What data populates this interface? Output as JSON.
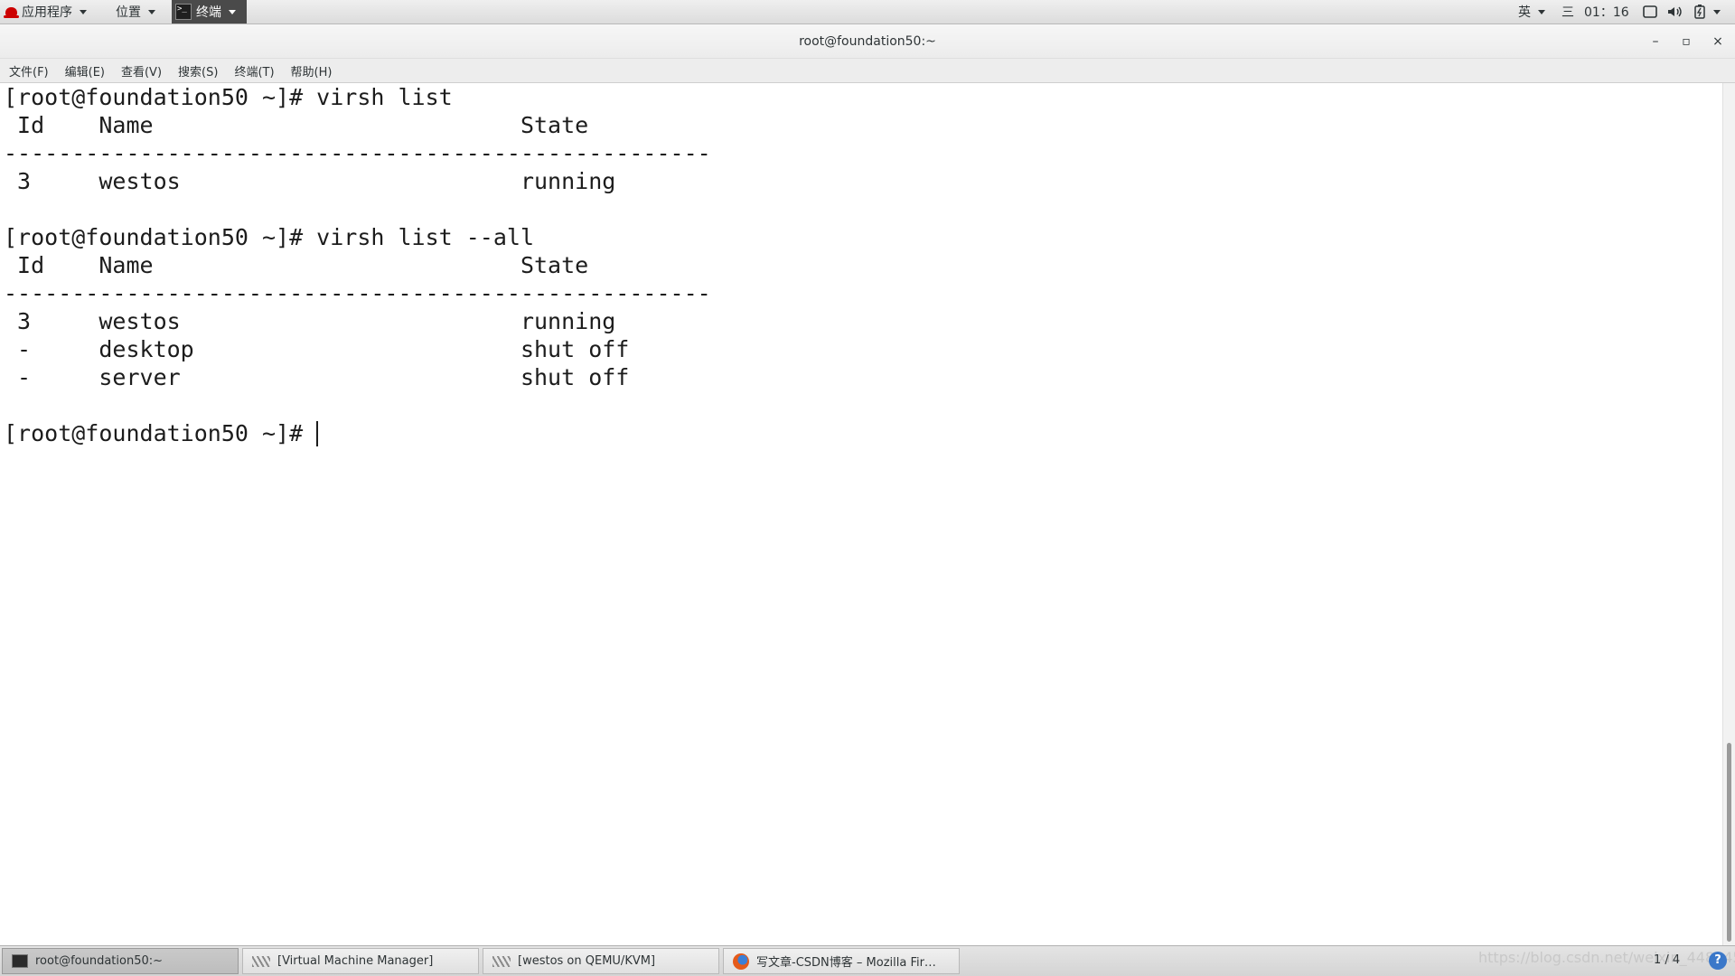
{
  "top_panel": {
    "applications": "应用程序",
    "places": "位置",
    "terminal_app": "终端",
    "language": "英",
    "day": "三",
    "time": "01：16"
  },
  "window": {
    "title": "root@foundation50:~",
    "minimize": "–",
    "maximize": "▫",
    "close": "×"
  },
  "menu": {
    "items": [
      "文件(F)",
      "编辑(E)",
      "查看(V)",
      "搜索(S)",
      "终端(T)",
      "帮助(H)"
    ]
  },
  "terminal": {
    "prompt": "[root@foundation50 ~]# ",
    "lines": [
      "[root@foundation50 ~]# virsh list",
      " Id    Name                           State",
      "----------------------------------------------------",
      " 3     westos                         running",
      "",
      "[root@foundation50 ~]# virsh list --all",
      " Id    Name                           State",
      "----------------------------------------------------",
      " 3     westos                         running",
      " -     desktop                        shut off",
      " -     server                         shut off",
      ""
    ]
  },
  "taskbar": {
    "tasks": [
      "root@foundation50:~",
      "[Virtual Machine Manager]",
      "[westos on QEMU/KVM]",
      "写文章-CSDN博客 – Mozilla Fir…"
    ],
    "pager": "1 / 4",
    "watermark": "https://blog.csdn.net/weixin_44824566"
  }
}
